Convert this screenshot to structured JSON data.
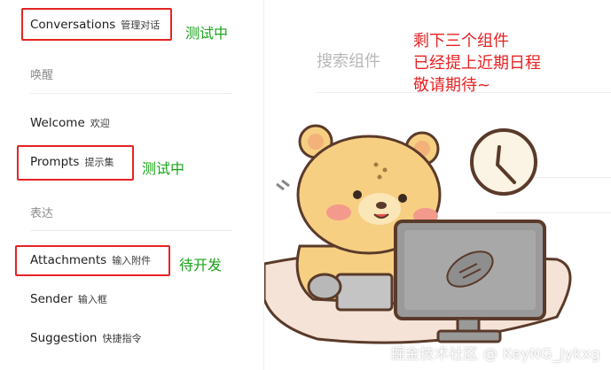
{
  "sidebar": {
    "conversations": {
      "label": "Conversations",
      "sub": "管理对话"
    },
    "group_wake": "唤醒",
    "welcome": {
      "label": "Welcome",
      "sub": "欢迎"
    },
    "prompts": {
      "label": "Prompts",
      "sub": "提示集"
    },
    "group_express": "表达",
    "attachments": {
      "label": "Attachments",
      "sub": "输入附件"
    },
    "sender": {
      "label": "Sender",
      "sub": "输入框"
    },
    "suggestion": {
      "label": "Suggestion",
      "sub": "快捷指令"
    }
  },
  "annotations": {
    "conversations_note": "测试中",
    "prompts_note": "测试中",
    "attachments_note": "待开发",
    "remaining": [
      "剩下三个组件",
      "已经提上近期日程",
      "敬请期待~"
    ]
  },
  "main": {
    "search_title": "搜索组件"
  },
  "watermark": "掘金技术社区 @ KeyNG_Jykxg",
  "colors": {
    "annotation_red": "#e62323",
    "annotation_green": "#1aa51a",
    "sticker_bear": "#f6cf82",
    "sticker_outline": "#5a3a2a"
  }
}
